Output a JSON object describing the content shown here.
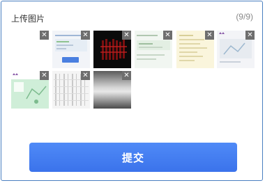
{
  "header": {
    "title": "上传图片",
    "counter": "(9/9)"
  },
  "thumbnails": [
    {
      "name": "thumbnail-1",
      "close": "✕"
    },
    {
      "name": "thumbnail-2",
      "close": "✕"
    },
    {
      "name": "thumbnail-3",
      "close": "✕"
    },
    {
      "name": "thumbnail-4",
      "close": "✕"
    },
    {
      "name": "thumbnail-5",
      "close": "✕"
    },
    {
      "name": "thumbnail-6",
      "close": "✕"
    },
    {
      "name": "thumbnail-7",
      "close": "✕"
    },
    {
      "name": "thumbnail-8",
      "close": "✕"
    },
    {
      "name": "thumbnail-9",
      "close": "✕"
    }
  ],
  "submit": {
    "label": "提交"
  },
  "colors": {
    "accent": "#3b73eb",
    "border": "#4a7fc0"
  }
}
